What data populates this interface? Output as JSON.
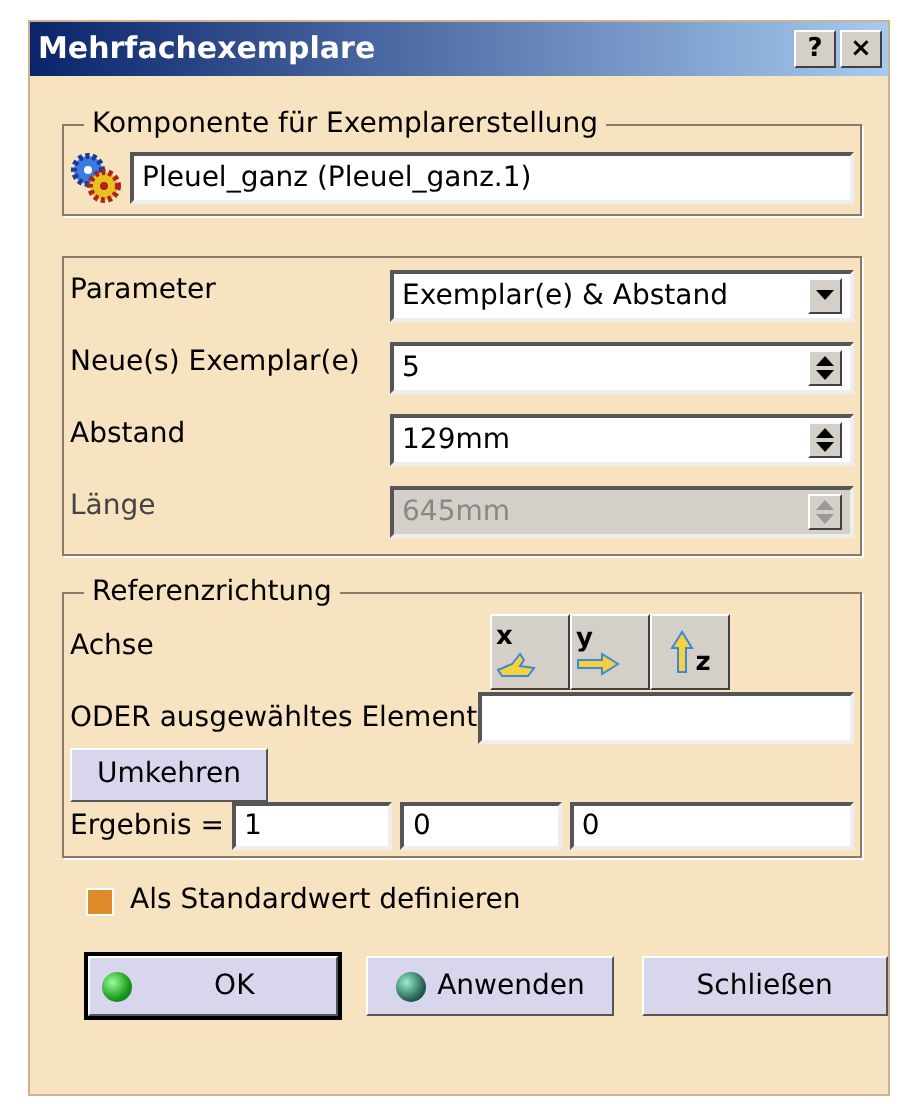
{
  "window": {
    "title": "Mehrfachexemplare",
    "title_buttons": [
      "?",
      "×"
    ]
  },
  "component_group": {
    "legend": "Komponente für Exemplarerstellung",
    "value": "Pleuel_ganz (Pleuel_ganz.1)"
  },
  "parameters": [
    {
      "label": "Parameter",
      "kind": "combo",
      "value": "Exemplar(e) & Abstand",
      "disabled": false
    },
    {
      "label": "Neue(s) Exemplar(e)",
      "kind": "spinner",
      "value": "5",
      "disabled": false
    },
    {
      "label": "Abstand",
      "kind": "spinner",
      "value": "129mm",
      "disabled": false
    },
    {
      "label": "Länge",
      "kind": "spinner",
      "value": "645mm",
      "disabled": true
    }
  ],
  "reference": {
    "legend": "Referenzrichtung",
    "axis_label": "Achse",
    "axis_buttons": [
      "x",
      "y",
      "z"
    ],
    "element_label": "ODER ausgewähltes Element",
    "reverse_button": "Umkehren",
    "result_label": "Ergebnis =",
    "result_values": [
      "1",
      "0",
      "0"
    ]
  },
  "default_checkbox": {
    "label": "Als Standardwert definieren",
    "checked": false
  },
  "buttons": [
    {
      "label": "OK",
      "kind": "confirm",
      "default": true
    },
    {
      "label": "Anwenden",
      "kind": "apply",
      "default": false
    },
    {
      "label": "Schließen",
      "kind": "plain",
      "default": false
    }
  ]
}
